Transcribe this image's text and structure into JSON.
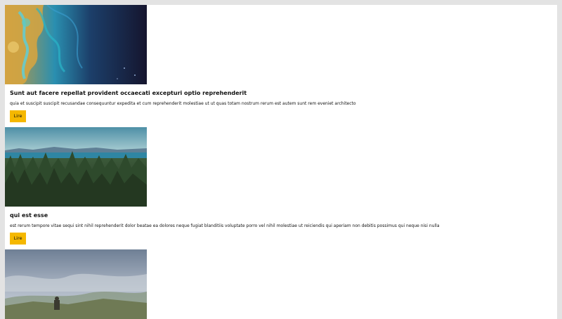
{
  "posts": [
    {
      "title": "Sunt aut facere repellat provident occaecati excepturi optio reprehenderit",
      "body": "quia et suscipit suscipit recusandae consequuntur expedita et cum reprehenderit molestiae ut ut quas totam nostrum rerum est autem sunt rem eveniet architecto",
      "button_label": "Lire",
      "image": "satellite-coast-photo"
    },
    {
      "title": "qui est esse",
      "body": "est rerum tempore vitae sequi sint nihil reprehenderit dolor beatae ea dolores neque fugiat blanditiis voluptate porro vel nihil molestiae ut reiciendis qui aperiam non debitis possimus qui neque nisi nulla",
      "button_label": "Lire",
      "image": "forest-lake-photo"
    },
    {
      "title": "",
      "body": "",
      "button_label": "",
      "image": "misty-mountain-photo"
    }
  ],
  "colors": {
    "page_bg": "#ffffff",
    "outer_bg": "#e3e3e3",
    "button_bg": "#f5b800"
  }
}
